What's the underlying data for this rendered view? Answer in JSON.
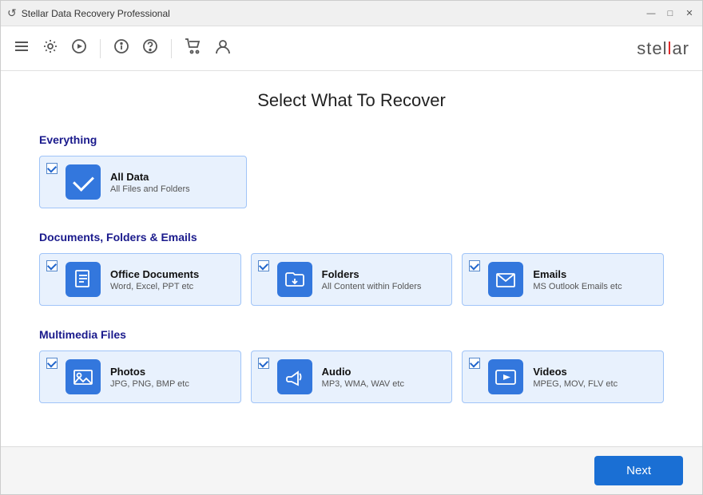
{
  "titleBar": {
    "icon": "↺",
    "title": "Stellar Data Recovery Professional",
    "btnMinimize": "—",
    "btnMaximize": "□",
    "btnClose": "✕"
  },
  "toolbar": {
    "menuIcon": "☰",
    "settingsIcon": "⚙",
    "playIcon": "▶",
    "infoIcon1": "ℹ",
    "infoIcon2": "?",
    "cartIcon": "🛒",
    "userIcon": "👤",
    "logoText1": "stel",
    "logoAccent": "l",
    "logoText2": "ar"
  },
  "page": {
    "title": "Select What To Recover"
  },
  "sections": {
    "everything": {
      "label": "Everything",
      "cards": [
        {
          "id": "alldata",
          "checked": true,
          "title": "All Data",
          "subtitle": "All Files and Folders",
          "iconType": "checkmark"
        }
      ]
    },
    "documents": {
      "label": "Documents, Folders & Emails",
      "cards": [
        {
          "id": "officedocs",
          "checked": true,
          "title": "Office Documents",
          "subtitle": "Word, Excel, PPT etc",
          "iconType": "document"
        },
        {
          "id": "folders",
          "checked": true,
          "title": "Folders",
          "subtitle": "All Content within Folders",
          "iconType": "folder"
        },
        {
          "id": "emails",
          "checked": true,
          "title": "Emails",
          "subtitle": "MS Outlook Emails etc",
          "iconType": "email"
        }
      ]
    },
    "multimedia": {
      "label": "Multimedia Files",
      "cards": [
        {
          "id": "photos",
          "checked": true,
          "title": "Photos",
          "subtitle": "JPG, PNG, BMP etc",
          "iconType": "photo"
        },
        {
          "id": "audio",
          "checked": true,
          "title": "Audio",
          "subtitle": "MP3, WMA, WAV etc",
          "iconType": "audio"
        },
        {
          "id": "videos",
          "checked": true,
          "title": "Videos",
          "subtitle": "MPEG, MOV, FLV etc",
          "iconType": "video"
        }
      ]
    }
  },
  "footer": {
    "nextLabel": "Next"
  }
}
